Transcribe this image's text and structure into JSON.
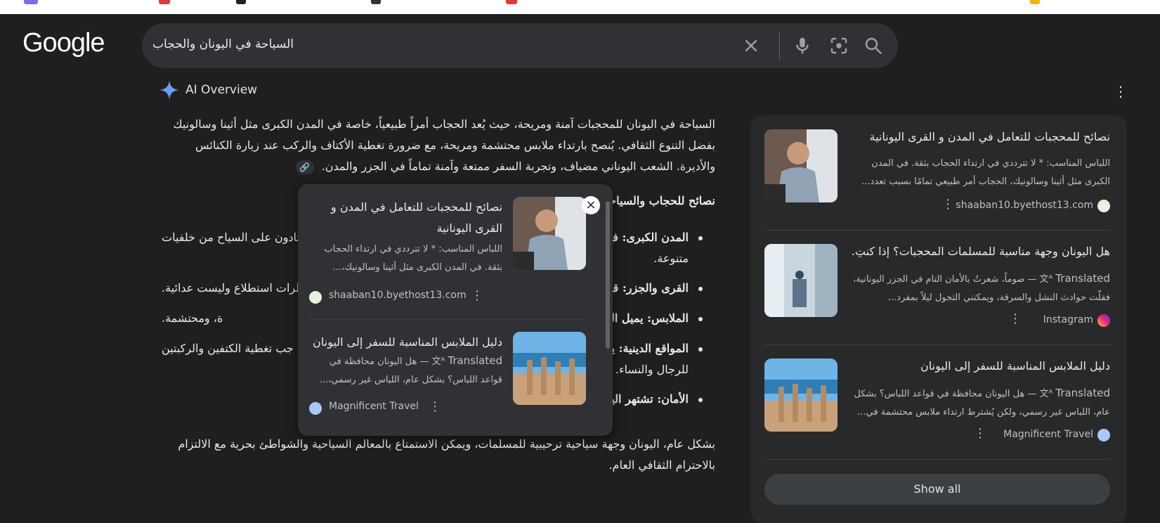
{
  "search": {
    "query": "السياحة في اليونان والحجاب",
    "brand": "Google"
  },
  "ai_overview": {
    "title": "AI Overview",
    "intro_text": "السياحة في اليونان للمحجبات آمنة ومريحة، حيث يُعد الحجاب أمراً طبيعياً، خاصة في المدن الكبرى مثل أثينا وسالونيك بفضل التنوع الثقافي. يُنصح بارتداء ملابس محتشمة ومريحة، مع ضرورة تغطية الأكتاف والركب عند زيارة الكنائس والأديرة. الشعب اليوناني مضياف، وتجربة السفر ممتعة وآمنة تماماً في الجزر والمدن.",
    "section_heading": "نصائح للحجاب والسياحة",
    "bullets": [
      {
        "lead": "المدن الكبرى: في",
        "tail": "معتادون على السياح من خلفيات",
        "tail2": "متنوعة."
      },
      {
        "lead": "القرى والجزر: قد",
        "tail": "نظرات استطلاع وليست عدائية.",
        "tail2": ""
      },
      {
        "lead": "الملابس: يميل اللبا",
        "tail": "ة، ومحتشمة.",
        "tail2": ""
      },
      {
        "lead": "المواقع الدينية: يج",
        "tail": "جب تغطية الكتفين والركبتين",
        "tail2": "للرجال والنساء."
      },
      {
        "lead": "الأمان: تشتهر اليونا",
        "tail": "",
        "tail2": ""
      }
    ],
    "closing_text": "بشكل عام، اليونان وجهة سياحية ترحيبية للمسلمات، ويمكن الاستمتاع بالمعالم السياحية والشواطئ بحرية مع الالتزام بالاحترام الثقافي العام."
  },
  "sources": [
    {
      "title": "نصائح للمحجبات للتعامل في المدن و القرى اليونانية",
      "snippet": "اللباس المناسب: * لا تترددي في ارتداء الحجاب بثقة. في المدن الكبرى مثل أثينا وسالونيك، الحجاب أمر طبيعي تمامًا بسبب تعدد...",
      "translated": "",
      "site": "shaaban10.byethost13.com"
    },
    {
      "title": "هل اليونان وجهة مناسبة للمسلمات المحجبات؟ إذا كنتِ...",
      "snippet": "— صوماً، شعرتُ بالأمان التام في الجزر اليونانية، فقلّت حوادث النشل والسرقة، ويمكنني التجول ليلاً بمفرد...",
      "translated": "Translated",
      "site": "Instagram"
    },
    {
      "title": "دليل الملابس المناسبة للسفر إلى اليونان",
      "snippet": "— هل اليونان محافظة في قواعد اللباس؟ بشكل عام، اللباس غير رسمي، ولكن يُشترط ارتداء ملابس محتشمة في...",
      "translated": "Translated",
      "site": "Magnificent Travel"
    }
  ],
  "show_all_label": "Show all",
  "popover": {
    "items": [
      {
        "title": "نصائح للمحجبات للتعامل في المدن و القرى اليونانية",
        "snippet": "اللباس المناسب: * لا تترددي في ارتداء الحجاب بثقة. في المدن الكبرى مثل أثينا وسالونيك،...",
        "translated": "",
        "site": "shaaban10.byethost13.com"
      },
      {
        "title": "دليل الملابس المناسبة للسفر إلى اليونان",
        "snippet": "— هل اليونان محافظة في قواعد اللباس؟ بشكل عام، اللباس غير رسمي،...",
        "translated": "Translated",
        "site": "Magnificent Travel"
      }
    ],
    "close_glyph": "×"
  },
  "icons": {
    "clear": "close-icon",
    "voice": "microphone-icon",
    "lens": "lens-icon",
    "search": "search-icon",
    "ai": "sparkle-icon",
    "link": "link-icon",
    "more": "more-vert-icon"
  },
  "colors": {
    "background": "#1f1f1f",
    "searchbar": "#303134",
    "sidecard": "#28292a",
    "highlight": "#223757"
  }
}
